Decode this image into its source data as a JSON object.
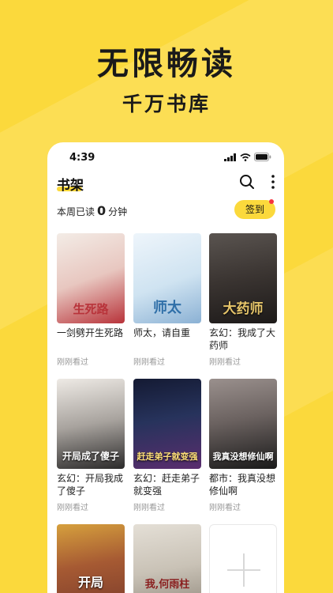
{
  "hero": {
    "title": "无限畅读",
    "subtitle": "千万书库"
  },
  "status_bar": {
    "time": "4:39"
  },
  "header": {
    "title": "书架"
  },
  "weekly": {
    "prefix": "本周已读",
    "minutes": "0",
    "suffix": "分钟"
  },
  "checkin": {
    "label": "签到"
  },
  "books": [
    {
      "title": "一剑劈开生死路",
      "status": "刚刚看过",
      "cover_text": "生死路",
      "cover_colors": [
        "#f3ece6",
        "#b8333a"
      ]
    },
    {
      "title": "师太，请自重",
      "status": "刚刚看过",
      "cover_text": "师太",
      "cover_colors": [
        "#cfe3f1",
        "#2f6fa8"
      ]
    },
    {
      "title": "玄幻：我成了大药师",
      "status": "刚刚看过",
      "cover_text": "大药师",
      "cover_colors": [
        "#3a3431",
        "#c23a2c"
      ]
    },
    {
      "title": "玄幻：开局我成了傻子",
      "status": "刚刚看过",
      "cover_text": "开局成了傻子",
      "cover_colors": [
        "#d9d5d0",
        "#2b2a2a"
      ]
    },
    {
      "title": "玄幻：赶走弟子就变强",
      "status": "刚刚看过",
      "cover_text": "赶走弟子就变强",
      "cover_colors": [
        "#27335c",
        "#e8b53b"
      ]
    },
    {
      "title": "都市：我真没想修仙啊",
      "status": "刚刚看过",
      "cover_text": "我真没想修仙啊",
      "cover_colors": [
        "#6b6260",
        "#1a1a1a"
      ]
    },
    {
      "cover_text": "开局",
      "cover_colors": [
        "#7a3b2b",
        "#d6a03d"
      ]
    },
    {
      "cover_text": "我,何雨柱",
      "cover_colors": [
        "#c9c2b6",
        "#8a1f1f"
      ]
    }
  ],
  "icons": {
    "search": "search-icon",
    "more": "more-vertical-icon",
    "add": "add-book-icon",
    "signal": "signal-icon",
    "wifi": "wifi-icon",
    "battery": "battery-icon"
  },
  "colors": {
    "accent": "#fbd93c",
    "badge": "#f5333f"
  }
}
